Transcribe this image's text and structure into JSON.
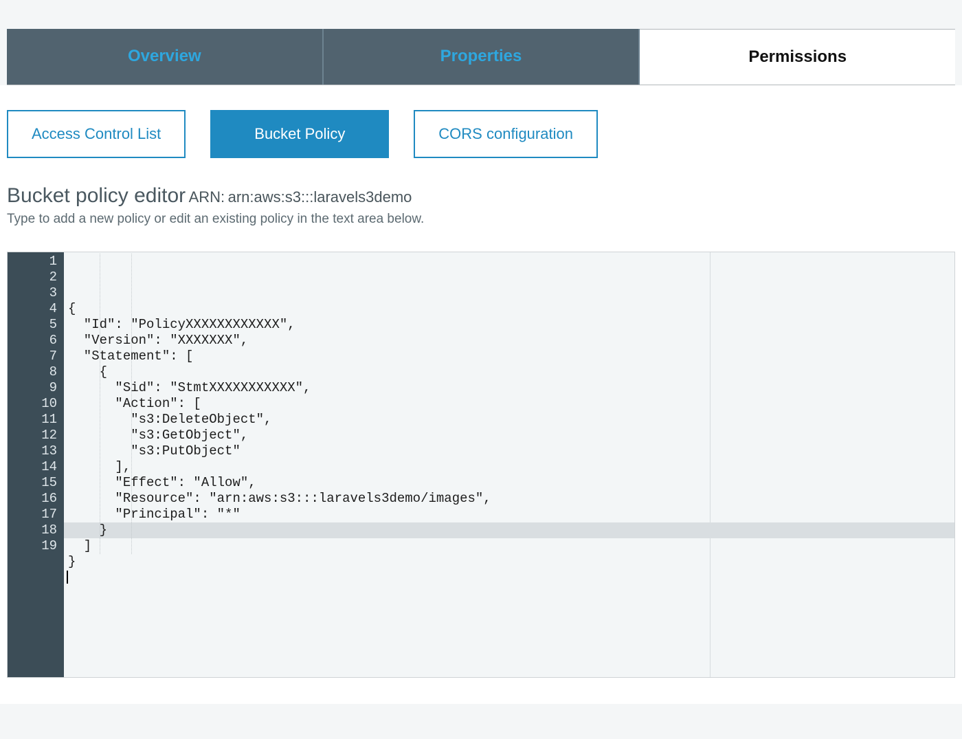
{
  "tabs": {
    "overview": "Overview",
    "properties": "Properties",
    "permissions": "Permissions"
  },
  "subtabs": {
    "acl": "Access Control List",
    "bucket_policy": "Bucket Policy",
    "cors": "CORS configuration"
  },
  "editor": {
    "title": "Bucket policy editor",
    "arn_label": "ARN:",
    "arn_value": "arn:aws:s3:::laravels3demo",
    "subtitle": "Type to add a new policy or edit an existing policy in the text area below."
  },
  "code": {
    "line_count": 19,
    "current_line": 18,
    "lines": [
      "{",
      "  \"Id\": \"PolicyXXXXXXXXXXXX\",",
      "  \"Version\": \"XXXXXXX\",",
      "  \"Statement\": [",
      "    {",
      "      \"Sid\": \"StmtXXXXXXXXXXX\",",
      "      \"Action\": [",
      "        \"s3:DeleteObject\",",
      "        \"s3:GetObject\",",
      "        \"s3:PutObject\"",
      "      ],",
      "      \"Effect\": \"Allow\",",
      "      \"Resource\": \"arn:aws:s3:::laravels3demo/images\",",
      "      \"Principal\": \"*\"",
      "    }",
      "  ]",
      "}",
      "",
      ""
    ]
  }
}
